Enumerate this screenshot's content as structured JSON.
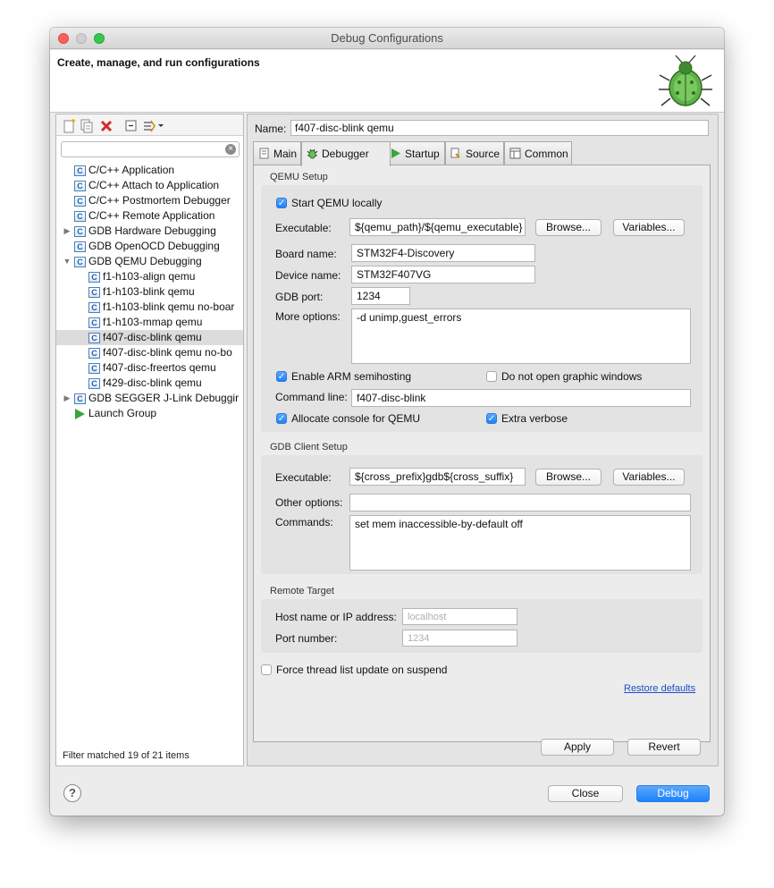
{
  "window": {
    "title": "Debug Configurations"
  },
  "header": {
    "title": "Create, manage, and run configurations"
  },
  "left": {
    "toolbar": [
      "new-config-icon",
      "duplicate-icon",
      "delete-icon",
      "collapse-all-icon",
      "filter-icon"
    ],
    "filter_placeholder": "",
    "tree": [
      {
        "label": "C/C++ Application",
        "level": 0,
        "icon": "c-icon",
        "twisty": ""
      },
      {
        "label": "C/C++ Attach to Application",
        "level": 0,
        "icon": "c-icon",
        "twisty": ""
      },
      {
        "label": "C/C++ Postmortem Debugger",
        "level": 0,
        "icon": "c-icon",
        "twisty": ""
      },
      {
        "label": "C/C++ Remote Application",
        "level": 0,
        "icon": "c-icon",
        "twisty": ""
      },
      {
        "label": "GDB Hardware Debugging",
        "level": 0,
        "icon": "c-icon",
        "twisty": "▶"
      },
      {
        "label": "GDB OpenOCD Debugging",
        "level": 0,
        "icon": "c-icon",
        "twisty": ""
      },
      {
        "label": "GDB QEMU Debugging",
        "level": 0,
        "icon": "c-icon",
        "twisty": "▼"
      },
      {
        "label": "f1-h103-align qemu",
        "level": 1,
        "icon": "c-icon",
        "twisty": ""
      },
      {
        "label": "f1-h103-blink qemu",
        "level": 1,
        "icon": "c-icon",
        "twisty": ""
      },
      {
        "label": "f1-h103-blink qemu no-boar",
        "level": 1,
        "icon": "c-icon",
        "twisty": ""
      },
      {
        "label": "f1-h103-mmap qemu",
        "level": 1,
        "icon": "c-icon",
        "twisty": ""
      },
      {
        "label": "f407-disc-blink qemu",
        "level": 1,
        "icon": "c-icon",
        "twisty": "",
        "selected": true
      },
      {
        "label": "f407-disc-blink qemu no-bo",
        "level": 1,
        "icon": "c-icon",
        "twisty": ""
      },
      {
        "label": "f407-disc-freertos qemu",
        "level": 1,
        "icon": "c-icon",
        "twisty": ""
      },
      {
        "label": "f429-disc-blink qemu",
        "level": 1,
        "icon": "c-icon",
        "twisty": ""
      },
      {
        "label": "GDB SEGGER J-Link Debuggir",
        "level": 0,
        "icon": "c-icon",
        "twisty": "▶"
      },
      {
        "label": "Launch Group",
        "level": 0,
        "icon": "launch-group-icon",
        "twisty": ""
      }
    ],
    "filter_status": "Filter matched 19 of 21 items"
  },
  "config": {
    "name_label": "Name:",
    "name_value": "f407-disc-blink qemu",
    "tabs": [
      {
        "label": "Main",
        "icon": "main-tab-icon"
      },
      {
        "label": "Debugger",
        "icon": "debugger-tab-icon",
        "active": true
      },
      {
        "label": "Startup",
        "icon": "startup-tab-icon"
      },
      {
        "label": "Source",
        "icon": "source-tab-icon"
      },
      {
        "label": "Common",
        "icon": "common-tab-icon"
      }
    ],
    "qemu": {
      "title": "QEMU Setup",
      "start_locally": "Start QEMU locally",
      "executable_label": "Executable:",
      "executable_value": "${qemu_path}/${qemu_executable}",
      "browse": "Browse...",
      "variables": "Variables...",
      "board_label": "Board name:",
      "board_value": "STM32F4-Discovery",
      "device_label": "Device name:",
      "device_value": "STM32F407VG",
      "port_label": "GDB port:",
      "port_value": "1234",
      "more_label": "More options:",
      "more_value": "-d unimp,guest_errors",
      "semihosting": "Enable ARM semihosting",
      "no_graphic": "Do not open graphic windows",
      "cmdline_label": "Command line:",
      "cmdline_value": "f407-disc-blink",
      "console": "Allocate console for QEMU",
      "verbose": "Extra verbose"
    },
    "gdb": {
      "title": "GDB Client Setup",
      "executable_label": "Executable:",
      "executable_value": "${cross_prefix}gdb${cross_suffix}",
      "browse": "Browse...",
      "variables": "Variables...",
      "other_label": "Other options:",
      "other_value": "",
      "commands_label": "Commands:",
      "commands_value": "set mem inaccessible-by-default off"
    },
    "remote": {
      "title": "Remote Target",
      "host_label": "Host name or IP address:",
      "host_value": "localhost",
      "port_label": "Port number:",
      "port_value": "1234"
    },
    "force_thread": "Force thread list update on suspend",
    "restore": "Restore defaults",
    "apply": "Apply",
    "revert": "Revert"
  },
  "footer": {
    "help": "?",
    "close": "Close",
    "debug": "Debug"
  }
}
